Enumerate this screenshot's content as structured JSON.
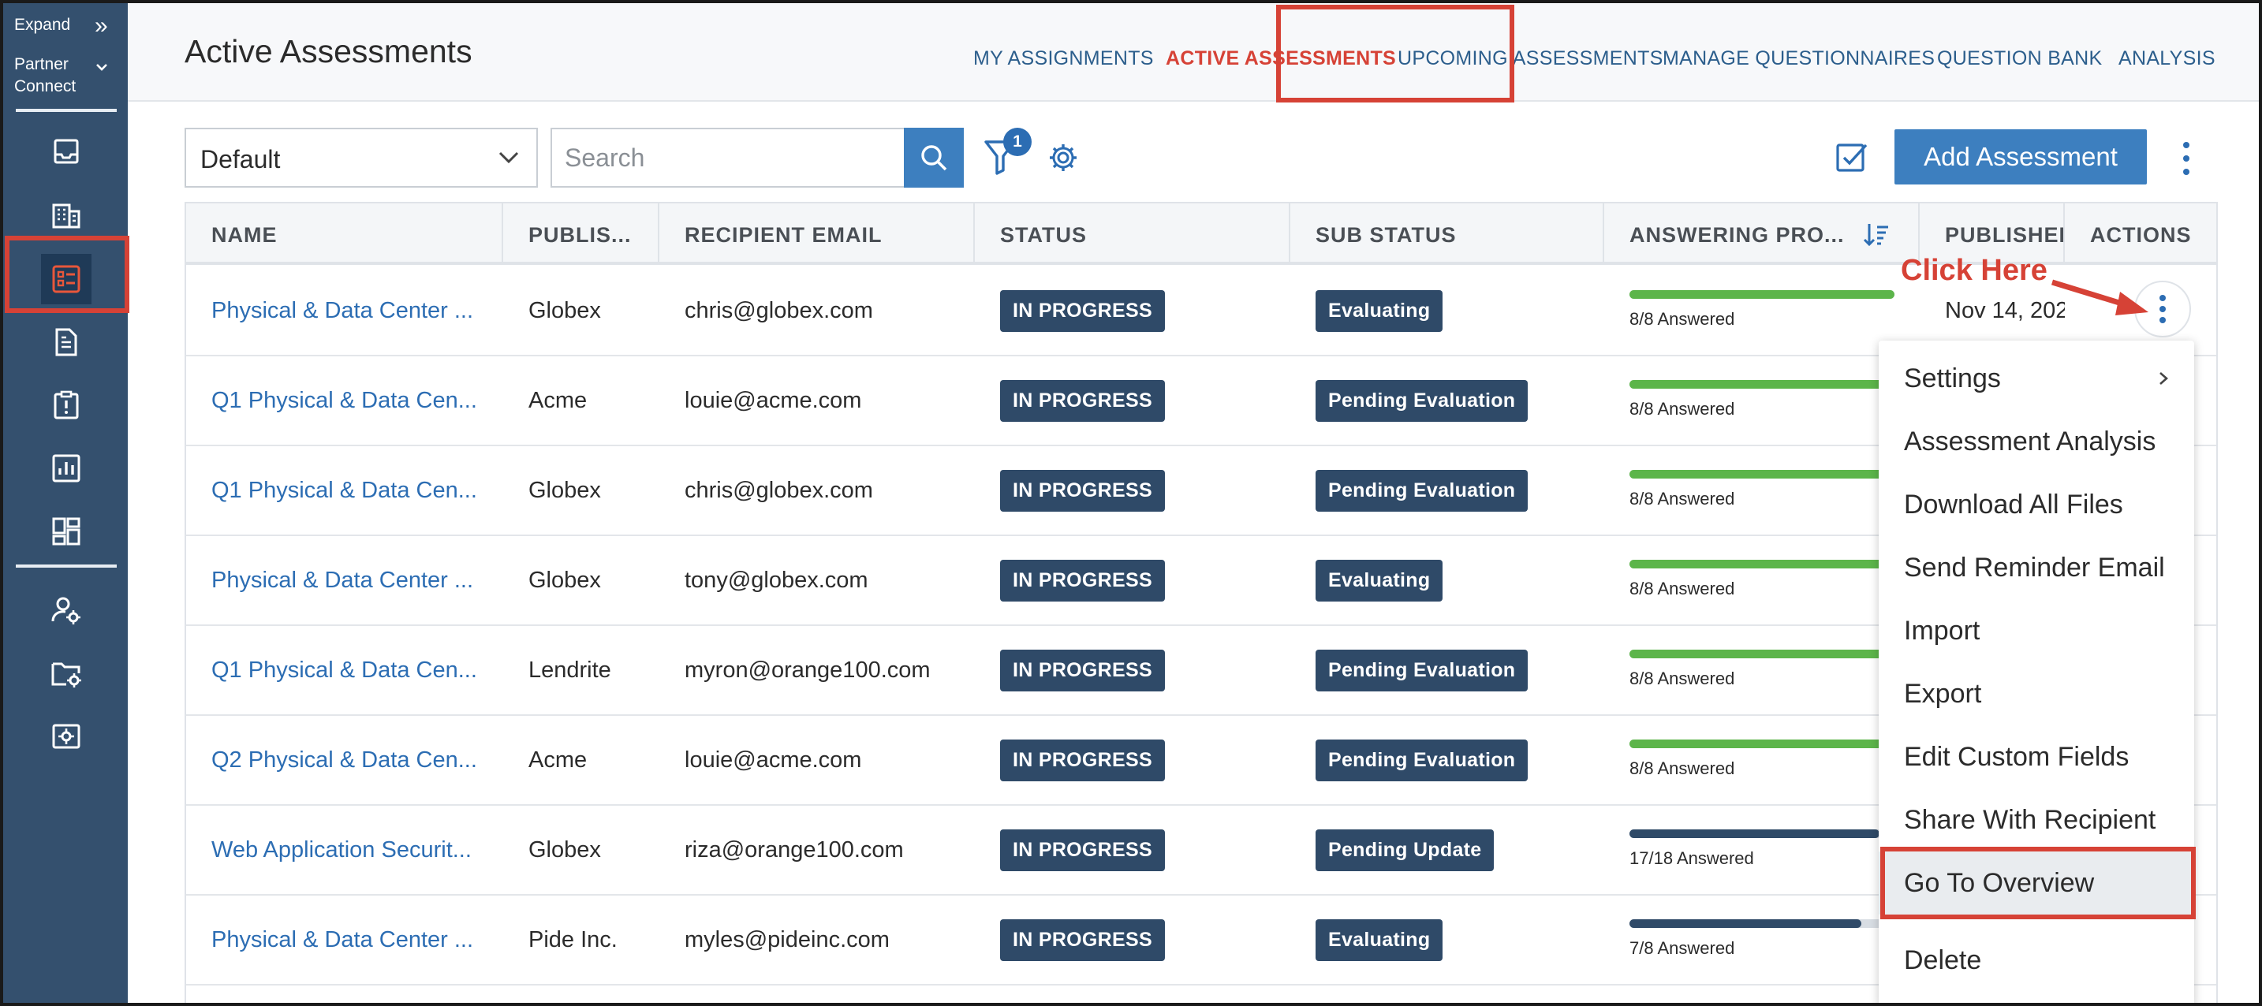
{
  "sidebar": {
    "expand_label": "Expand",
    "workspace_line1": "Partner",
    "workspace_line2": "Connect",
    "icons": [
      "inbox-icon",
      "building-icon",
      "assessment-list-icon",
      "document-icon",
      "alert-clipboard-icon",
      "report-chart-icon",
      "dashboard-icon",
      "user-settings-icon",
      "folder-settings-icon",
      "admin-settings-icon"
    ]
  },
  "header": {
    "title": "Active Assessments",
    "tabs": [
      {
        "label": "MY ASSIGNMENTS"
      },
      {
        "label": "ACTIVE ASSESSMENTS"
      },
      {
        "label": "UPCOMING ASSESSMENTS"
      },
      {
        "label": "MANAGE QUESTIONNAIRES"
      },
      {
        "label": "QUESTION BANK"
      },
      {
        "label": "ANALYSIS"
      }
    ],
    "active_tab": "ACTIVE ASSESSMENTS"
  },
  "toolbar": {
    "view_value": "Default",
    "search_placeholder": "Search",
    "filter_count": "1",
    "add_button_label": "Add Assessment"
  },
  "table": {
    "columns": [
      "NAME",
      "PUBLIS...",
      "RECIPIENT EMAIL",
      "STATUS",
      "SUB STATUS",
      "ANSWERING PRO...",
      "PUBLISHED",
      "ACTIONS"
    ],
    "rows": [
      {
        "name": "Physical & Data Center ...",
        "publisher": "Globex",
        "email": "chris@globex.com",
        "status": "IN PROGRESS",
        "sub_status": "Evaluating",
        "progress": 1.0,
        "answered": "8/8 Answered",
        "progress_color": "#5cb54a",
        "published": "Nov 14, 202"
      },
      {
        "name": "Q1 Physical & Data Cen...",
        "publisher": "Acme",
        "email": "louie@acme.com",
        "status": "IN PROGRESS",
        "sub_status": "Pending Evaluation",
        "progress": 1.0,
        "answered": "8/8 Answered",
        "progress_color": "#5cb54a",
        "published": ""
      },
      {
        "name": "Q1 Physical & Data Cen...",
        "publisher": "Globex",
        "email": "chris@globex.com",
        "status": "IN PROGRESS",
        "sub_status": "Pending Evaluation",
        "progress": 1.0,
        "answered": "8/8 Answered",
        "progress_color": "#5cb54a",
        "published": ""
      },
      {
        "name": "Physical & Data Center ...",
        "publisher": "Globex",
        "email": "tony@globex.com",
        "status": "IN PROGRESS",
        "sub_status": "Evaluating",
        "progress": 1.0,
        "answered": "8/8 Answered",
        "progress_color": "#5cb54a",
        "published": ""
      },
      {
        "name": "Q1 Physical & Data Cen...",
        "publisher": "Lendrite",
        "email": "myron@orange100.com",
        "status": "IN PROGRESS",
        "sub_status": "Pending Evaluation",
        "progress": 1.0,
        "answered": "8/8 Answered",
        "progress_color": "#5cb54a",
        "published": ""
      },
      {
        "name": "Q2 Physical & Data Cen...",
        "publisher": "Acme",
        "email": "louie@acme.com",
        "status": "IN PROGRESS",
        "sub_status": "Pending Evaluation",
        "progress": 1.0,
        "answered": "8/8 Answered",
        "progress_color": "#5cb54a",
        "published": ""
      },
      {
        "name": "Web Application Securit...",
        "publisher": "Globex",
        "email": "riza@orange100.com",
        "status": "IN PROGRESS",
        "sub_status": "Pending Update",
        "progress": 0.944,
        "answered": "17/18 Answered",
        "progress_color": "#2f4a68",
        "published": ""
      },
      {
        "name": "Physical & Data Center ...",
        "publisher": "Pide Inc.",
        "email": "myles@pideinc.com",
        "status": "IN PROGRESS",
        "sub_status": "Evaluating",
        "progress": 0.875,
        "answered": "7/8 Answered",
        "progress_color": "#2f4a68",
        "published": ""
      }
    ]
  },
  "annotation": {
    "text": "Click Here"
  },
  "actions_menu": {
    "items": [
      {
        "label": "Settings",
        "has_submenu": true
      },
      {
        "label": "Assessment Analysis"
      },
      {
        "label": "Download All Files"
      },
      {
        "label": "Send Reminder Email"
      },
      {
        "label": "Import"
      },
      {
        "label": "Export"
      },
      {
        "label": "Edit Custom Fields"
      },
      {
        "label": "Share With Recipient"
      },
      {
        "label": "Go To Overview",
        "highlighted": true
      },
      {
        "label": "Delete"
      }
    ]
  },
  "colors": {
    "sidebar": "#34506e",
    "accent": "#3d7fbf",
    "link": "#2c6db3",
    "badge": "#2f4a68",
    "annotation": "#d64236",
    "progress_complete": "#5cb54a"
  }
}
